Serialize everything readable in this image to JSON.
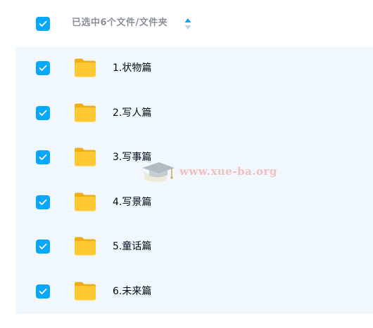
{
  "header": {
    "title": "已选中6个文件/文件夹",
    "select_all_checked": true
  },
  "files": [
    {
      "name": "1.状物篇",
      "type": "folder",
      "checked": true
    },
    {
      "name": "2.写人篇",
      "type": "folder",
      "checked": true
    },
    {
      "name": "3.写事篇",
      "type": "folder",
      "checked": true
    },
    {
      "name": "4.写景篇",
      "type": "folder",
      "checked": true
    },
    {
      "name": "5.童话篇",
      "type": "folder",
      "checked": true
    },
    {
      "name": "6.未来篇",
      "type": "folder",
      "checked": true
    }
  ],
  "watermark": {
    "text": "www.xue-ba.org"
  },
  "colors": {
    "accent": "#06a7ff",
    "selected_row_bg": "#f1f8fd",
    "folder": "#ffc933",
    "header_text": "#8a8f99",
    "row_text": "#03081a"
  },
  "icons": {
    "checkbox": "checkmark-icon",
    "folder": "folder-icon",
    "sort": "sort-icon"
  }
}
